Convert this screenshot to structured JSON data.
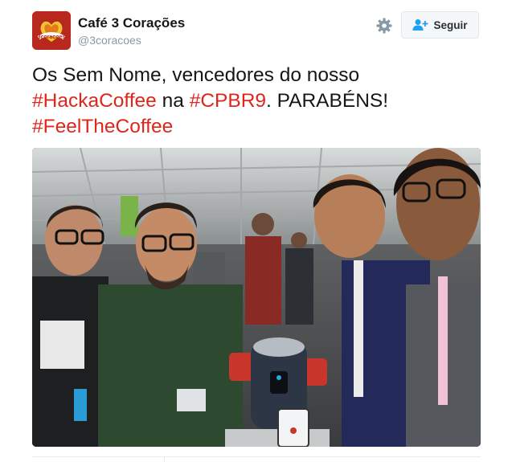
{
  "account": {
    "display_name": "Café 3 Corações",
    "handle": "@3coracoes",
    "avatar_text": "3coracoes",
    "follow_label": "Seguir"
  },
  "tweet": {
    "text_1": "Os Sem Nome, vencedores do nosso",
    "hashtag_1": "#HackaCoffee",
    "text_2": " na ",
    "hashtag_2": "#CPBR9",
    "text_3": ". PARABÉNS!",
    "hashtag_3": "#FeelTheCoffee"
  },
  "icons": {
    "settings": "gear-icon",
    "follow": "add-user-icon"
  },
  "colors": {
    "hashtag": "#e0251b",
    "avatar_bg": "#b8281d",
    "text": "#14171a",
    "muted": "#8899a6"
  }
}
